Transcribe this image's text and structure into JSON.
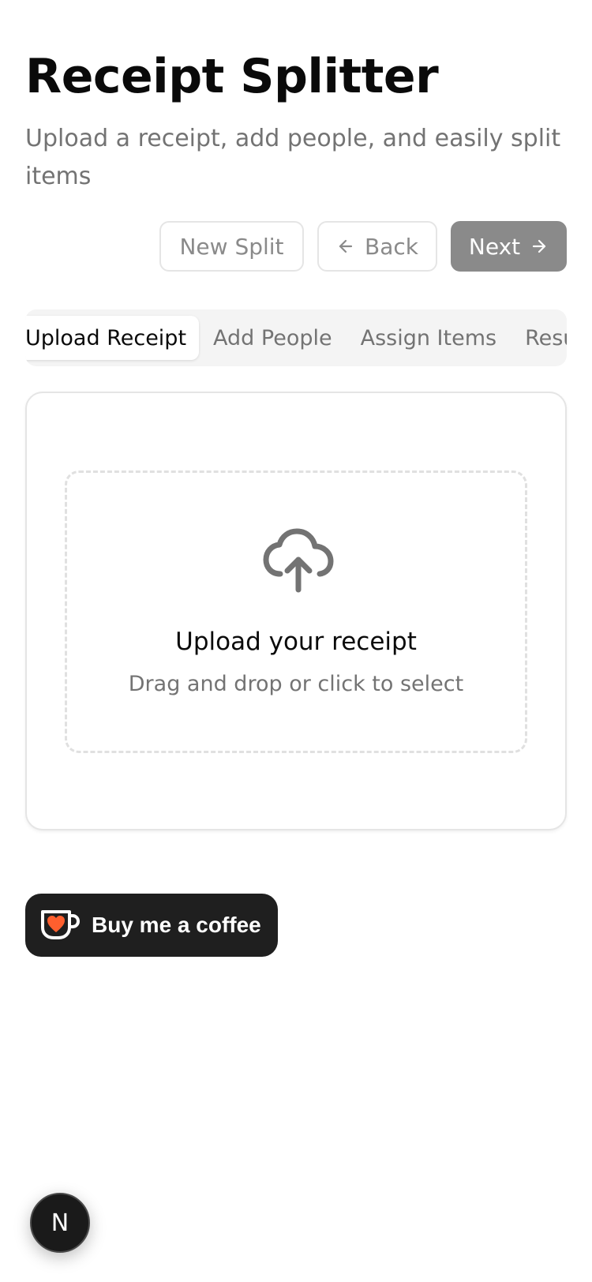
{
  "header": {
    "title": "Receipt Splitter",
    "subtitle": "Upload a receipt, add people, and easily split items"
  },
  "actions": {
    "new_split": "New Split",
    "back": "Back",
    "next": "Next"
  },
  "tabs": [
    {
      "label": "Upload Receipt",
      "active": true
    },
    {
      "label": "Add People",
      "active": false
    },
    {
      "label": "Assign Items",
      "active": false
    },
    {
      "label": "Results",
      "active": false
    }
  ],
  "upload": {
    "icon": "cloud-upload-icon",
    "title": "Upload your receipt",
    "subtitle": "Drag and drop or click to select"
  },
  "coffee_button": {
    "label": "Buy me a coffee",
    "icon": "coffee-cup-heart-icon"
  },
  "dev_badge": {
    "label": "N"
  },
  "colors": {
    "text": "#0a0a0a",
    "muted": "#737373",
    "border": "#e5e5e5",
    "next_button_bg": "#8a8a8a",
    "coffee_bg": "#1f1f1f",
    "heart": "#ff5f2e"
  }
}
